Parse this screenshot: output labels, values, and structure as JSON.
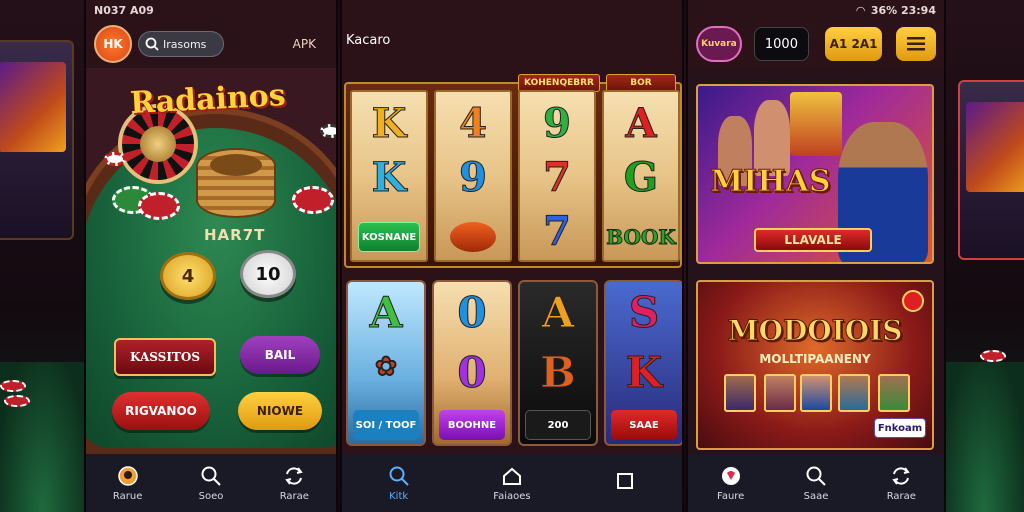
{
  "phone1": {
    "status": {
      "time": "N037 A09"
    },
    "header": {
      "logo": "HK",
      "search_label": "Irasoms",
      "apk_label": "APK"
    },
    "table": {
      "brand_title": "Radainos",
      "label": "HAR7T",
      "coin_left": "4",
      "coin_right": "10",
      "btn_kassitos": "KASSITOS",
      "btn_purple": "BAIL",
      "btn_red": "RIGVANOO",
      "btn_gold": "NIOWE"
    },
    "nav": [
      {
        "label": "Rarue",
        "icon": "chat-icon"
      },
      {
        "label": "Soeo",
        "icon": "search-icon"
      },
      {
        "label": "Rarae",
        "icon": "refresh-icon"
      }
    ]
  },
  "phone2": {
    "title": "Kacaro",
    "reel_tabs": [
      "KOHENQEBRR",
      "BOR"
    ],
    "reels": [
      {
        "symbols": [
          "K",
          "K"
        ],
        "button": "KOSNANE",
        "colors": [
          "#f0b020",
          "#f0a020"
        ]
      },
      {
        "symbols": [
          "4",
          "9"
        ],
        "button": "",
        "colors": [
          "#f08020",
          "#2090e0"
        ]
      },
      {
        "symbols": [
          "9",
          "7",
          "7"
        ],
        "button": "",
        "colors": [
          "#30b040",
          "#e03020",
          "#3060e0"
        ]
      },
      {
        "symbols": [
          "A",
          "G"
        ],
        "button": "BOOK",
        "colors": [
          "#e02020",
          "#20a020"
        ]
      }
    ],
    "cards": [
      {
        "symbol": "A",
        "button": "SOI / TOOF",
        "color": "#40c040"
      },
      {
        "symbol": "0",
        "button": "BOOHNE",
        "color": "#a030e0"
      },
      {
        "symbol": "A",
        "button": "200",
        "color": "#f0a020"
      },
      {
        "symbol": "S",
        "button": "SAAE",
        "color": "#e02060"
      }
    ],
    "card_middle_symbols": [
      "",
      "0",
      "B",
      "K"
    ],
    "nav": [
      {
        "label": "Kitk",
        "icon": "search-icon"
      },
      {
        "label": "Faiaoes",
        "icon": "home-icon"
      },
      {
        "label": "",
        "icon": "square-icon"
      }
    ]
  },
  "phone3": {
    "status": {
      "right": "36% 23:94"
    },
    "header": {
      "avatar_label": "Kuvara",
      "balance": "1000",
      "btn_label": "A1 2A1"
    },
    "promo1": {
      "title": "MIHAS",
      "subtitle": "LLAVALE"
    },
    "promo2": {
      "title": "MODOIOIS",
      "subtitle": "MOLLTIPAANENY",
      "button": "Fnkoam"
    },
    "nav": [
      {
        "label": "Faure",
        "icon": "chat-icon"
      },
      {
        "label": "Saae",
        "icon": "search-icon"
      },
      {
        "label": "Rarae",
        "icon": "refresh-icon"
      }
    ]
  },
  "colors": {
    "gold": "#ffd23a",
    "nav_bg": "#191a26",
    "felt": "#17603a"
  }
}
